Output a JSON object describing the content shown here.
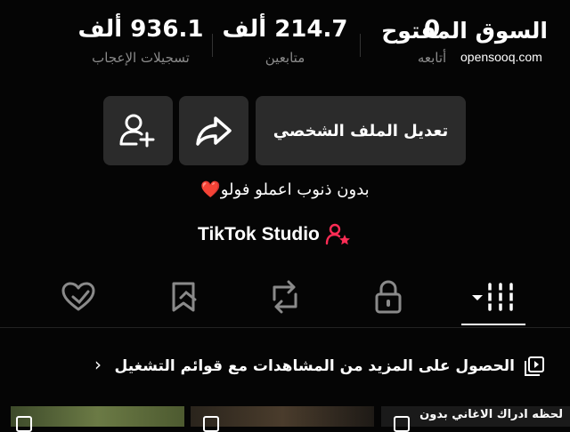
{
  "stats": {
    "likes": {
      "value": "936.1 ألف",
      "label": "تسجيلات الإعجاب"
    },
    "followers": {
      "value": "214.7 ألف",
      "label": "متابعين"
    },
    "following": {
      "value": "0",
      "label": "أتابعه"
    }
  },
  "watermark": {
    "arabic": "السوق المفتوح",
    "latin": "opensooq.com"
  },
  "buttons": {
    "edit_profile": "تعديل الملف الشخصي"
  },
  "bio": {
    "text": "بدون ذنوب اعملو فولو",
    "heart": "❤️"
  },
  "studio": {
    "label": "TikTok Studio"
  },
  "tabs": [
    {
      "name": "videos",
      "icon": "grid-icon"
    },
    {
      "name": "private",
      "icon": "lock-icon"
    },
    {
      "name": "reposts",
      "icon": "repost-icon"
    },
    {
      "name": "favorites",
      "icon": "bookmark-icon"
    },
    {
      "name": "liked",
      "icon": "heart-icon"
    }
  ],
  "playlist": {
    "text": "الحصول على المزيد من المشاهدات مع قوائم التشغيل",
    "chevron": "›"
  },
  "thumbnail_caption": "لحظه ادراك الاغاني بدون"
}
